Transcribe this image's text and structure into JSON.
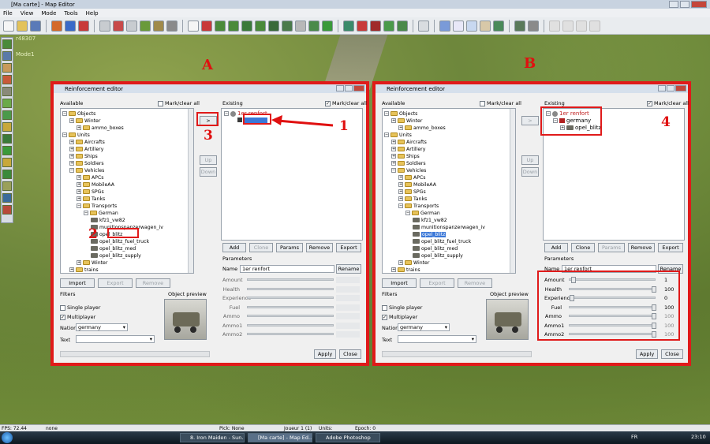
{
  "app": {
    "title": "[Ma carte] - Map Editor",
    "menu": [
      "File",
      "View",
      "Mode",
      "Tools",
      "Help"
    ],
    "coords": "r48307",
    "mode": "Mode1"
  },
  "labels": {
    "A": "A",
    "B": "B",
    "n1": "1",
    "n2": "2",
    "n3": "3",
    "n4": "4"
  },
  "dialogA": {
    "title": "Reinforcement editor",
    "available_label": "Available",
    "mark_clear_all": "Mark/clear all",
    "existing_label": "Existing",
    "move_button": ">",
    "up_button": "Up",
    "down_button": "Down",
    "tree": [
      {
        "exp": "−",
        "icon": "folder",
        "label": "Objects"
      },
      {
        "exp": "+",
        "icon": "folder",
        "label": "Winter"
      },
      {
        "exp": "+",
        "icon": "folder",
        "label": "ammo_boxes"
      },
      {
        "exp": "−",
        "icon": "folder",
        "label": "Units"
      },
      {
        "exp": "+",
        "icon": "folder",
        "label": "Aircrafts"
      },
      {
        "exp": "+",
        "icon": "folder",
        "label": "Artillery"
      },
      {
        "exp": "+",
        "icon": "folder",
        "label": "Ships"
      },
      {
        "exp": "+",
        "icon": "folder",
        "label": "Soldiers"
      },
      {
        "exp": "−",
        "icon": "folder",
        "label": "Vehicles"
      },
      {
        "exp": "+",
        "icon": "folder",
        "label": "APCs"
      },
      {
        "exp": "+",
        "icon": "folder",
        "label": "MobileAA"
      },
      {
        "exp": "+",
        "icon": "folder",
        "label": "SPGs"
      },
      {
        "exp": "+",
        "icon": "folder",
        "label": "Tanks"
      },
      {
        "exp": "−",
        "icon": "folder",
        "label": "Transports"
      },
      {
        "exp": "−",
        "icon": "folder",
        "label": "German"
      },
      {
        "exp": "",
        "icon": "truck",
        "label": "kfz1_vw82"
      },
      {
        "exp": "",
        "icon": "truck",
        "label": "munitionspanzerwagen_iv"
      },
      {
        "exp": "",
        "icon": "truck",
        "label": "opel_blitz"
      },
      {
        "exp": "",
        "icon": "truck",
        "label": "opel_blitz_fuel_truck"
      },
      {
        "exp": "",
        "icon": "truck",
        "label": "opel_blitz_med"
      },
      {
        "exp": "",
        "icon": "truck",
        "label": "opel_blitz_supply"
      },
      {
        "exp": "+",
        "icon": "folder",
        "label": "Winter"
      },
      {
        "exp": "+",
        "icon": "folder",
        "label": "trains"
      }
    ],
    "existing_tree": [
      {
        "exp": "−",
        "icon": "gear",
        "label": "1er renfort"
      }
    ],
    "buttons_left": [
      "Import",
      "Export",
      "Remove"
    ],
    "buttons_right": [
      "Add",
      "Clone",
      "Params",
      "Remove",
      "Export"
    ],
    "filters_label": "Filters",
    "single_player": "Single player",
    "multiplayer": "Multiplayer",
    "nation_label": "Nation",
    "nation_value": "germany",
    "text_label": "Text",
    "object_preview": "Object preview",
    "parameters_label": "Parameters",
    "name_label": "Name",
    "name_value": "1er renfort",
    "rename_button": "Rename",
    "params": [
      {
        "label": "Amount",
        "value": ""
      },
      {
        "label": "Health",
        "value": ""
      },
      {
        "label": "Experience",
        "value": ""
      },
      {
        "label": "Fuel",
        "value": ""
      },
      {
        "label": "Ammo",
        "value": ""
      },
      {
        "label": "Ammo1",
        "value": ""
      },
      {
        "label": "Ammo2",
        "value": ""
      }
    ],
    "apply": "Apply",
    "close": "Close"
  },
  "dialogB": {
    "title": "Reinforcement editor",
    "existing_tree": [
      {
        "exp": "−",
        "icon": "gear",
        "label": "1er renfort"
      },
      {
        "exp": "−",
        "icon": "flag",
        "label": "germany"
      },
      {
        "exp": "+",
        "icon": "truck",
        "label": "opel_blitz"
      }
    ],
    "params": [
      {
        "label": "Amount",
        "value": "1",
        "level": 0.02
      },
      {
        "label": "Health",
        "value": "100",
        "level": 1
      },
      {
        "label": "Experience",
        "value": "0",
        "level": 0
      },
      {
        "label": "Fuel",
        "value": "100",
        "level": 1
      },
      {
        "label": "Ammo",
        "value": "100",
        "level": 1
      },
      {
        "label": "Ammo1",
        "value": "100",
        "level": 1
      },
      {
        "label": "Ammo2",
        "value": "100",
        "level": 1
      }
    ]
  },
  "status": {
    "fps": "FPS: 72.44",
    "mode": "none",
    "pick": "Pick: None",
    "player": "Joueur 1 (1)",
    "units": "Units:",
    "epoch": "Epoch: 0"
  },
  "taskbar": {
    "tasks": [
      "8. Iron Maiden - Sun...",
      "[Ma carte] - Map Ed...",
      "Adobe Photoshop"
    ],
    "lang": "FR",
    "time": "23:10"
  }
}
